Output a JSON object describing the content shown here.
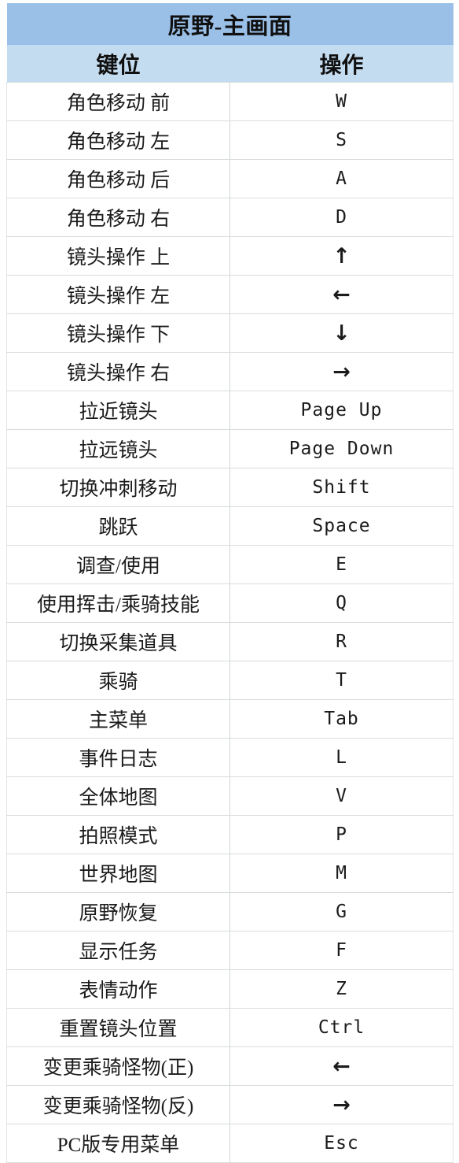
{
  "table": {
    "title": "原野-主画面",
    "columns": [
      {
        "label": "键位",
        "name": "action-column"
      },
      {
        "label": "操作",
        "name": "key-column"
      }
    ],
    "rows": [
      {
        "action": "角色移动 前",
        "key": "W",
        "key_kind": "text"
      },
      {
        "action": "角色移动 左",
        "key": "S",
        "key_kind": "text"
      },
      {
        "action": "角色移动 后",
        "key": "A",
        "key_kind": "text"
      },
      {
        "action": "角色移动 右",
        "key": "D",
        "key_kind": "text"
      },
      {
        "action": "镜头操作 上",
        "key": "↑",
        "key_kind": "arrow-up"
      },
      {
        "action": "镜头操作 左",
        "key": "←",
        "key_kind": "arrow-left"
      },
      {
        "action": "镜头操作 下",
        "key": "↓",
        "key_kind": "arrow-down"
      },
      {
        "action": "镜头操作 右",
        "key": "→",
        "key_kind": "arrow-right"
      },
      {
        "action": "拉近镜头",
        "key": "Page Up",
        "key_kind": "text"
      },
      {
        "action": "拉远镜头",
        "key": "Page Down",
        "key_kind": "text"
      },
      {
        "action": "切换冲刺移动",
        "key": "Shift",
        "key_kind": "text"
      },
      {
        "action": "跳跃",
        "key": "Space",
        "key_kind": "text"
      },
      {
        "action": "调查/使用",
        "key": "E",
        "key_kind": "text"
      },
      {
        "action": "使用挥击/乘骑技能",
        "key": "Q",
        "key_kind": "text"
      },
      {
        "action": "切换采集道具",
        "key": "R",
        "key_kind": "text"
      },
      {
        "action": "乘骑",
        "key": "T",
        "key_kind": "text"
      },
      {
        "action": "主菜单",
        "key": "Tab",
        "key_kind": "text"
      },
      {
        "action": "事件日志",
        "key": "L",
        "key_kind": "text"
      },
      {
        "action": "全体地图",
        "key": "V",
        "key_kind": "text"
      },
      {
        "action": "拍照模式",
        "key": "P",
        "key_kind": "text"
      },
      {
        "action": "世界地图",
        "key": "M",
        "key_kind": "text"
      },
      {
        "action": "原野恢复",
        "key": "G",
        "key_kind": "text"
      },
      {
        "action": "显示任务",
        "key": "F",
        "key_kind": "text"
      },
      {
        "action": "表情动作",
        "key": "Z",
        "key_kind": "text"
      },
      {
        "action": "重置镜头位置",
        "key": "Ctrl",
        "key_kind": "text"
      },
      {
        "action": "变更乘骑怪物(正)",
        "key": "←",
        "key_kind": "arrow-left"
      },
      {
        "action": "变更乘骑怪物(反)",
        "key": "→",
        "key_kind": "arrow-right"
      },
      {
        "action": "PC版专用菜单",
        "key": "Esc",
        "key_kind": "text"
      }
    ]
  },
  "colors": {
    "title_bg": "#9ac0e8",
    "column_header_bg": "#c4dcf0",
    "row_bg": "#ffffff",
    "grid_line": "#d9dcdd",
    "text": "#1b1b1b"
  }
}
